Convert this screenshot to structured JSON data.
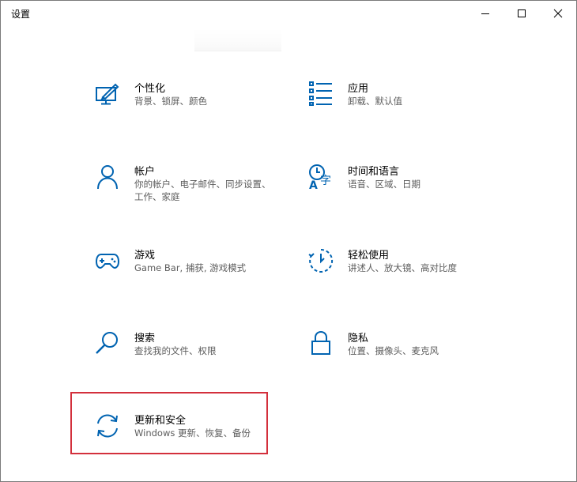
{
  "window": {
    "title": "设置",
    "controls": [
      "minimize",
      "maximize",
      "close"
    ]
  },
  "colors": {
    "accent": "#0063b1",
    "highlight_border": "#d3303c"
  },
  "tiles": [
    {
      "title": "个性化",
      "desc": "背景、锁屏、颜色",
      "icon": "personalization-icon"
    },
    {
      "title": "应用",
      "desc": "卸载、默认值",
      "icon": "apps-list-icon"
    },
    {
      "title": "帐户",
      "desc": "你的帐户、电子邮件、同步设置、工作、家庭",
      "icon": "person-icon"
    },
    {
      "title": "时间和语言",
      "desc": "语音、区域、日期",
      "icon": "time-language-icon"
    },
    {
      "title": "游戏",
      "desc": "Game Bar, 捕获, 游戏模式",
      "icon": "gamepad-icon"
    },
    {
      "title": "轻松使用",
      "desc": "讲述人、放大镜、高对比度",
      "icon": "ease-of-access-icon"
    },
    {
      "title": "搜索",
      "desc": "查找我的文件、权限",
      "icon": "search-icon"
    },
    {
      "title": "隐私",
      "desc": "位置、摄像头、麦克风",
      "icon": "lock-icon"
    },
    {
      "title": "更新和安全",
      "desc": "Windows 更新、恢复、备份",
      "icon": "sync-icon"
    }
  ]
}
